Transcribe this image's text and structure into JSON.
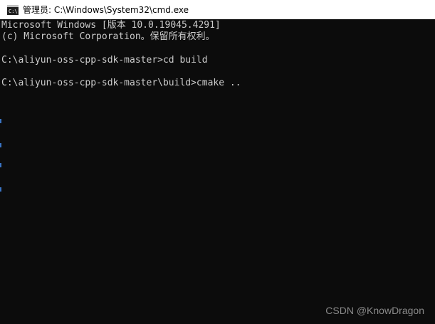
{
  "window": {
    "title": "管理员: C:\\Windows\\System32\\cmd.exe",
    "icon": "cmd-icon"
  },
  "console": {
    "lines": [
      "Microsoft Windows [版本 10.0.19045.4291]",
      "(c) Microsoft Corporation。保留所有权利。",
      "",
      "C:\\aliyun-oss-cpp-sdk-master>cd build",
      "",
      "C:\\aliyun-oss-cpp-sdk-master\\build>cmake .."
    ]
  },
  "watermark": "CSDN @KnowDragon",
  "colors": {
    "background": "#0c0c0c",
    "text": "#cccccc",
    "titlebar": "#ffffff"
  }
}
